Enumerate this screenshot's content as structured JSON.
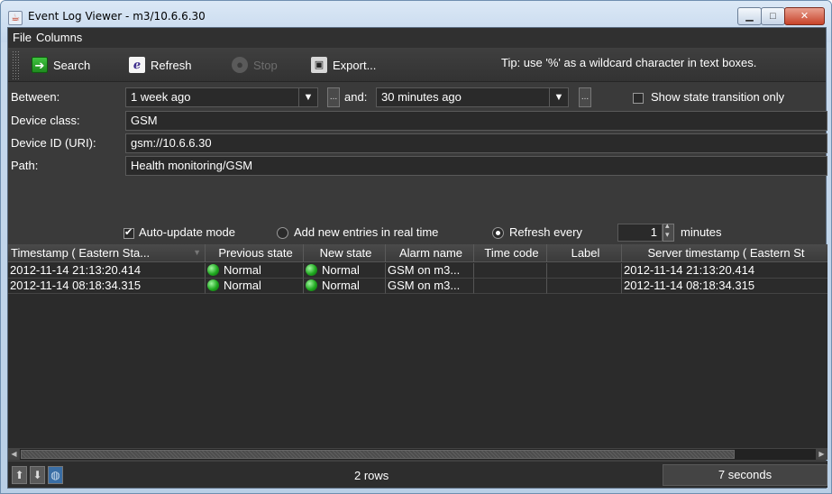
{
  "window": {
    "title": "Event Log Viewer - m3/10.6.6.30"
  },
  "menubar": {
    "items": [
      {
        "label": "File"
      },
      {
        "label": "Columns"
      }
    ]
  },
  "toolbar": {
    "search_label": "Search",
    "refresh_label": "Refresh",
    "stop_label": "Stop",
    "export_label": "Export...",
    "tip": "Tip: use '%' as a wildcard character in text boxes."
  },
  "filters": {
    "between_label": "Between:",
    "between_value": "1 week ago",
    "and_label": "and:",
    "and_value": "30 minutes ago",
    "state_transition_label": "Show state transition only",
    "state_transition_checked": false,
    "device_class_label": "Device class:",
    "device_class_value": "GSM",
    "device_id_label": "Device ID (URI):",
    "device_id_value": "gsm://10.6.6.30",
    "path_label": "Path:",
    "path_value": "Health monitoring/GSM"
  },
  "options": {
    "auto_update_label": "Auto-update mode",
    "auto_update_checked": true,
    "realtime_label": "Add new entries in real time",
    "refresh_every_label": "Refresh every",
    "refresh_every_value": "1",
    "minutes_label": "minutes",
    "selected_mode": "refresh_every"
  },
  "table": {
    "columns": [
      {
        "label": "Timestamp ( Eastern Sta...",
        "sortable": true
      },
      {
        "label": "Previous state"
      },
      {
        "label": "New state"
      },
      {
        "label": "Alarm name"
      },
      {
        "label": "Time code"
      },
      {
        "label": "Label"
      },
      {
        "label": "Server timestamp ( Eastern St"
      }
    ],
    "rows": [
      {
        "timestamp": "2012-11-14 21:13:20.414",
        "previous_state": "Normal",
        "new_state": "Normal",
        "alarm_name": "GSM on m3...",
        "time_code": "",
        "label": "",
        "server_timestamp": "2012-11-14 21:13:20.414"
      },
      {
        "timestamp": "2012-11-14 08:18:34.315",
        "previous_state": "Normal",
        "new_state": "Normal",
        "alarm_name": "GSM on m3...",
        "time_code": "",
        "label": "",
        "server_timestamp": "2012-11-14 08:18:34.315"
      }
    ],
    "state_color": "#1fa81f"
  },
  "status": {
    "row_count": "2 rows",
    "elapsed": "7 seconds"
  },
  "colors": {
    "app_background": "#3a3a3a",
    "titlebar": "#c4d7ec",
    "close_button": "#c7432a"
  }
}
